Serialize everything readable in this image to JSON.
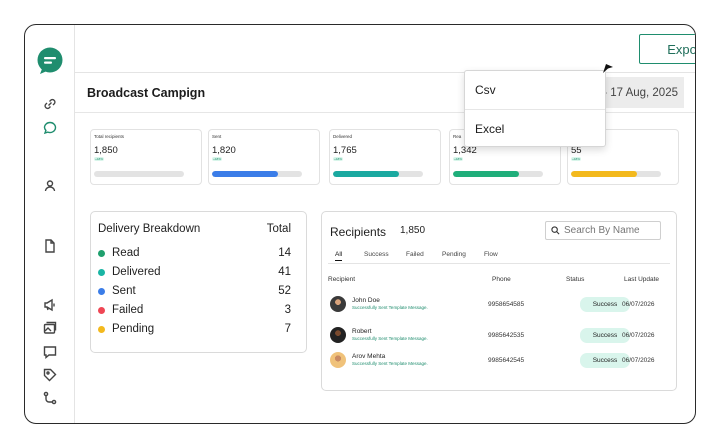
{
  "header": {
    "export_label": "Export",
    "page_title": "Broadcast Campign",
    "date_text": "- 17 Aug, 2025"
  },
  "export_menu": {
    "items": [
      "Csv",
      "Excel"
    ]
  },
  "stats": [
    {
      "label": "Total recipients",
      "value": "1,850",
      "delta": "+18%",
      "fill": 0,
      "color": "#d9d9d9"
    },
    {
      "label": "Sent",
      "value": "1,820",
      "delta": "+18%",
      "fill": 0.73,
      "color": "#3b7de8"
    },
    {
      "label": "Delivered",
      "value": "1,765",
      "delta": "+18%",
      "fill": 0.73,
      "color": "#1aa9a0"
    },
    {
      "label": "Rea",
      "value": "1,342",
      "delta": "+18%",
      "fill": 0.73,
      "color": "#1fae7a"
    },
    {
      "label": "",
      "value": "55",
      "delta": "+18%",
      "fill": 0.73,
      "color": "#f3b91d"
    }
  ],
  "breakdown": {
    "title": "Delivery Breakdown",
    "total_label": "Total",
    "rows": [
      {
        "label": "Read",
        "value": "14",
        "color": "#1fa06e"
      },
      {
        "label": "Delivered",
        "value": "41",
        "color": "#1ab5a4"
      },
      {
        "label": "Sent",
        "value": "52",
        "color": "#3b7de8"
      },
      {
        "label": "Failed",
        "value": "3",
        "color": "#ef4654"
      },
      {
        "label": "Pending",
        "value": "7",
        "color": "#f3b91d"
      }
    ]
  },
  "recipients": {
    "title": "Recipients",
    "count": "1,850",
    "search_placeholder": "Search By Name",
    "tabs": [
      "All",
      "Success",
      "Failed",
      "Pending",
      "Flow"
    ],
    "columns": [
      "Recipient",
      "Phone",
      "Status",
      "Last Update"
    ],
    "rows": [
      {
        "name": "John Doe",
        "message": "Successfully Sent Template Message.",
        "phone": "9958654585",
        "status": "Success",
        "date": "06/07/2026"
      },
      {
        "name": "Robert",
        "message": "Successfully Sent Template Message.",
        "phone": "9985642535",
        "status": "Success",
        "date": "06/07/2026"
      },
      {
        "name": "Arov Mehta",
        "message": "Successfully Sent Template Message.",
        "phone": "9985642545",
        "status": "Success",
        "date": "06/07/2026"
      }
    ]
  },
  "colors": {
    "brand": "#1f8d6e",
    "success_bg": "#d9f5ec"
  }
}
